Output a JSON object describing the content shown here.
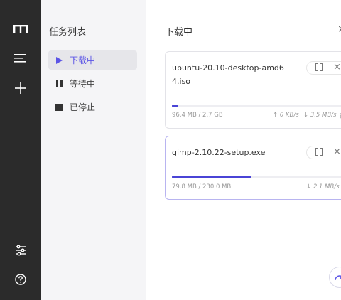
{
  "sidebar": {
    "title": "任务列表",
    "items": [
      {
        "label": "下载中"
      },
      {
        "label": "等待中"
      },
      {
        "label": "已停止"
      }
    ]
  },
  "main": {
    "heading": "下载中",
    "close": "×"
  },
  "tasks": [
    {
      "name": "ubuntu-20.10-desktop-amd64.iso",
      "progress": "96.4 MB / 2.7 GB",
      "upload": "↑ 0 KB/s",
      "download": "↓ 3.5 MB/s",
      "remaining_partial": "剩",
      "fraction": 0.035
    },
    {
      "name": "gimp-2.10.22-setup.exe",
      "progress": "79.8 MB / 230.0 MB",
      "download": "↓ 2.1 MB/s",
      "fraction": 0.347
    }
  ],
  "icons": {
    "logo": "logo-icon",
    "menu": "menu-icon",
    "add": "plus-icon",
    "settings": "sliders-icon",
    "help": "help-icon",
    "pause": "pause-icon",
    "remove": "close-icon"
  },
  "colors": {
    "accent": "#4a44d6",
    "rail": "#2b2b2b",
    "sidebar": "#f5f5f7"
  }
}
